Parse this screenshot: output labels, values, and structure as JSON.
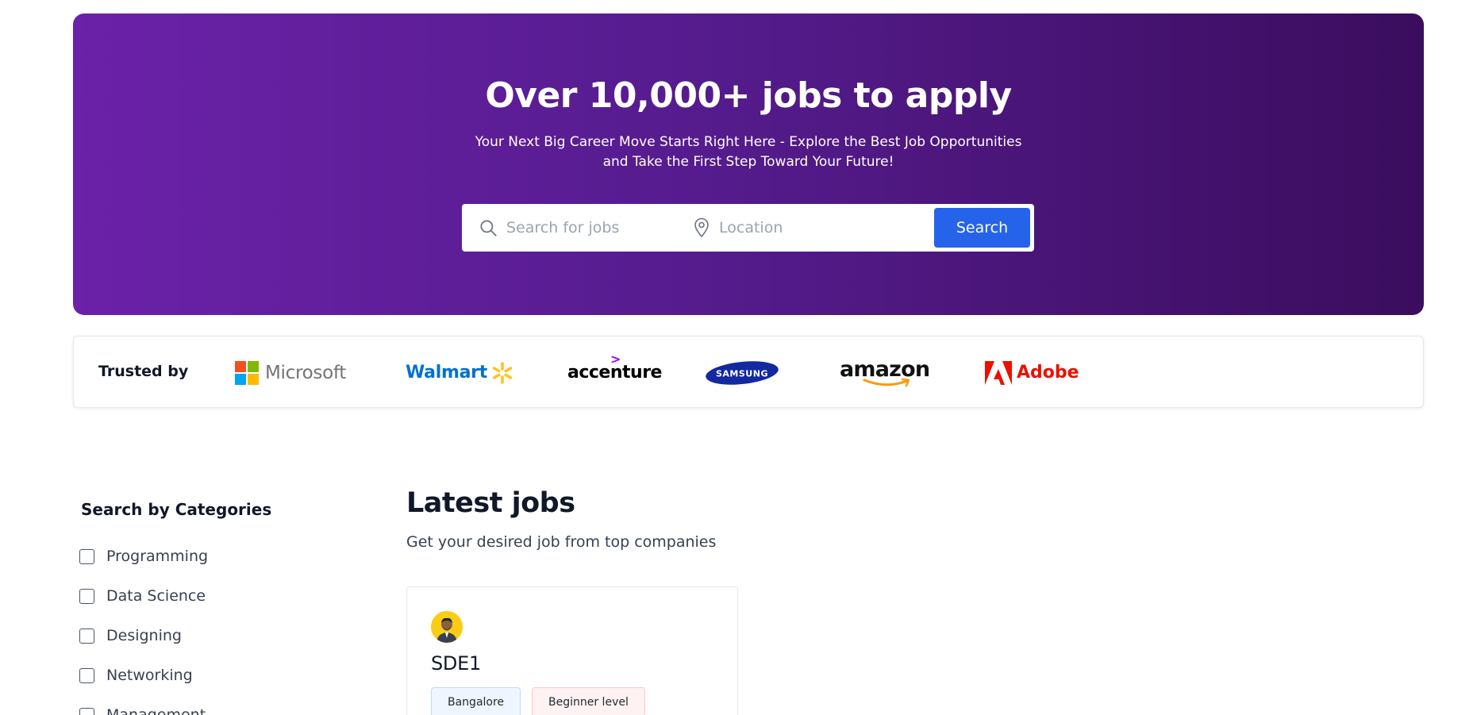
{
  "hero": {
    "title": "Over 10,000+ jobs to apply",
    "subtitle": "Your Next Big Career Move Starts Right Here - Explore the Best Job Opportunities and Take the First Step Toward Your Future!",
    "search": {
      "jobs_placeholder": "Search for jobs",
      "location_placeholder": "Location",
      "button_label": "Search"
    },
    "colors": {
      "gradient_start": "#6b21a8",
      "gradient_end": "#3b0d5e",
      "button": "#2563eb"
    }
  },
  "trusted": {
    "label": "Trusted by",
    "logos": [
      {
        "name": "Microsoft",
        "text": "Microsoft"
      },
      {
        "name": "Walmart",
        "text": "Walmart"
      },
      {
        "name": "Accenture",
        "text": "accenture"
      },
      {
        "name": "Samsung",
        "text": "SAMSUNG"
      },
      {
        "name": "Amazon",
        "text": "amazon"
      },
      {
        "name": "Adobe",
        "text": "Adobe"
      }
    ]
  },
  "categories": {
    "title": "Search by Categories",
    "items": [
      {
        "label": "Programming",
        "checked": false
      },
      {
        "label": "Data Science",
        "checked": false
      },
      {
        "label": "Designing",
        "checked": false
      },
      {
        "label": "Networking",
        "checked": false
      },
      {
        "label": "Management",
        "checked": false
      }
    ]
  },
  "latest_jobs": {
    "title": "Latest jobs",
    "subtitle": "Get your desired job from top companies",
    "jobs": [
      {
        "title": "SDE1",
        "location": "Bangalore",
        "level": "Beginner level",
        "avatar_icon": "person-avatar-icon"
      }
    ]
  }
}
